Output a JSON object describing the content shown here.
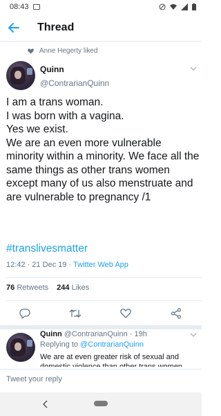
{
  "status_bar": {
    "time": "08:43"
  },
  "app_bar": {
    "title": "Thread"
  },
  "social_context": {
    "text": "Anne Hegerty liked"
  },
  "tweet": {
    "author_name": "Quinn",
    "author_handle": "@ContrarianQuinn",
    "text": "I am a trans woman.\nI was born with a vagina.\nYes we exist.\nWe are an even more vulnerable minority within a minority. We face all the same things as other trans women except many of us also menstruate and are vulnerable to pregnancy /1",
    "hashtag": "#translivesmatter",
    "timestamp": "12:42 · 21 Dec 19 · ",
    "source": "Twitter Web App",
    "retweets_count": "76",
    "retweets_label": "Retweets",
    "likes_count": "244",
    "likes_label": "Likes"
  },
  "reply": {
    "author_name": "Quinn",
    "author_handle_time": "@ContrarianQuinn · 19h",
    "replying_label": "Replying to ",
    "replying_mention": "@ContrarianQuinn",
    "text": "We are at even greater risk of sexual and domestic violence than other trans women"
  },
  "compose": {
    "placeholder": "Tweet your reply"
  },
  "colors": {
    "accent": "#1da1f2",
    "text": "#14171a",
    "secondary": "#657786",
    "divider": "#e6ecf0"
  }
}
